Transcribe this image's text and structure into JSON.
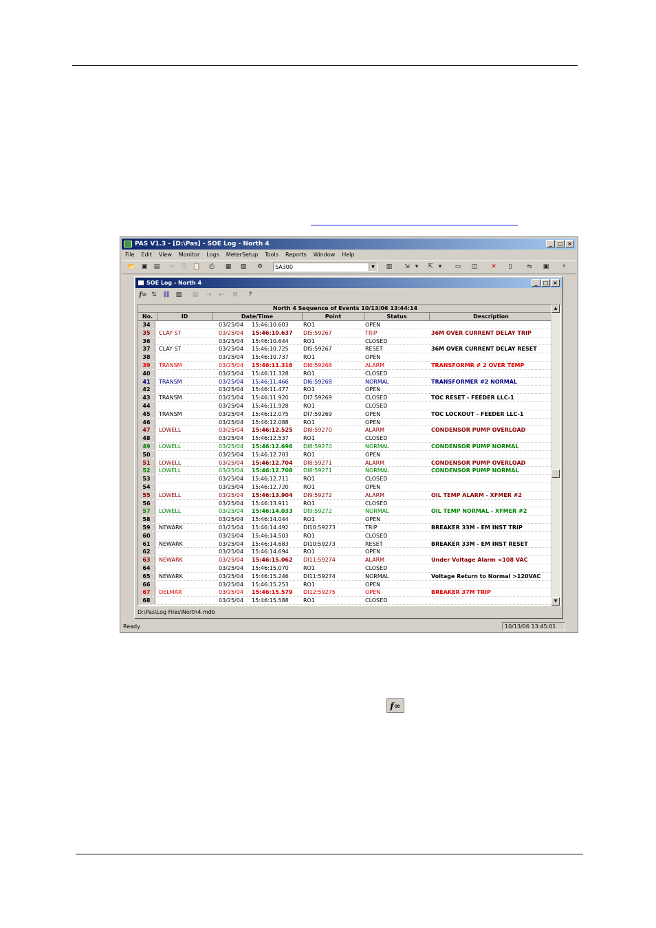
{
  "app": {
    "title": "PAS V1.3 - [D:\\Pas] - SOE Log - North 4",
    "menu": [
      "File",
      "Edit",
      "View",
      "Monitor",
      "Logs",
      "MeterSetup",
      "Tools",
      "Reports",
      "Window",
      "Help"
    ],
    "device_select": "SA300",
    "status_left": "Ready",
    "status_time": "10/13/06 13:45:01"
  },
  "doc": {
    "title": "SOE Log - North 4",
    "header_title": "North 4   Sequence of Events   10/13/06 13:44:14",
    "columns": [
      "No.",
      "ID",
      "Date/Time",
      "Point",
      "Status",
      "Description"
    ],
    "file_path": "D:\\Pas\\Log Files\\North4.mdb"
  },
  "rows": [
    {
      "no": "34",
      "id": "",
      "date": "03/25/04",
      "time": "15:46:10.603",
      "point": "RO1",
      "status": "OPEN",
      "desc": "",
      "color": "black"
    },
    {
      "no": "35",
      "id": "CLAY ST",
      "date": "03/25/04",
      "time": "15:46:10.637",
      "point": "DI5:59267",
      "status": "TRIP",
      "desc": "36M OVER CURRENT DELAY TRIP",
      "color": "darkred"
    },
    {
      "no": "36",
      "id": "",
      "date": "03/25/04",
      "time": "15:46:10.644",
      "point": "RO1",
      "status": "CLOSED",
      "desc": "",
      "color": "black"
    },
    {
      "no": "37",
      "id": "CLAY ST",
      "date": "03/25/04",
      "time": "15:46:10.725",
      "point": "DI5:59267",
      "status": "RESET",
      "desc": "36M OVER CURRENT DELAY RESET",
      "color": "black"
    },
    {
      "no": "38",
      "id": "",
      "date": "03/25/04",
      "time": "15:46:10.737",
      "point": "RO1",
      "status": "OPEN",
      "desc": "",
      "color": "black"
    },
    {
      "no": "39",
      "id": "TRANSM",
      "date": "03/25/04",
      "time": "15:46:11.316",
      "point": "DI6:59268",
      "status": "ALARM",
      "desc": "TRANSFORMR # 2 OVER TEMP",
      "color": "red"
    },
    {
      "no": "40",
      "id": "",
      "date": "03/25/04",
      "time": "15:46:11.328",
      "point": "RO1",
      "status": "CLOSED",
      "desc": "",
      "color": "black"
    },
    {
      "no": "41",
      "id": "TRANSM",
      "date": "03/25/04",
      "time": "15:46:11.466",
      "point": "DI6:59268",
      "status": "NORMAL",
      "desc": "TRANSFORMER #2 NORMAL",
      "color": "navy"
    },
    {
      "no": "42",
      "id": "",
      "date": "03/25/04",
      "time": "15:46:11.477",
      "point": "RO1",
      "status": "OPEN",
      "desc": "",
      "color": "black"
    },
    {
      "no": "43",
      "id": "TRANSM",
      "date": "03/25/04",
      "time": "15:46:11.920",
      "point": "DI7:59269",
      "status": "CLOSED",
      "desc": "TOC RESET - FEEDER LLC-1",
      "color": "black"
    },
    {
      "no": "44",
      "id": "",
      "date": "03/25/04",
      "time": "15:46:11.928",
      "point": "RO1",
      "status": "CLOSED",
      "desc": "",
      "color": "black"
    },
    {
      "no": "45",
      "id": "TRANSM",
      "date": "03/25/04",
      "time": "15:46:12.075",
      "point": "DI7:59269",
      "status": "OPEN",
      "desc": "TOC LOCKOUT - FEEDER LLC-1",
      "color": "black"
    },
    {
      "no": "46",
      "id": "",
      "date": "03/25/04",
      "time": "15:46:12.088",
      "point": "RO1",
      "status": "OPEN",
      "desc": "",
      "color": "black"
    },
    {
      "no": "47",
      "id": "LOWELL",
      "date": "03/25/04",
      "time": "15:46:12.525",
      "point": "DI8:59270",
      "status": "ALARM",
      "desc": "CONDENSOR PUMP OVERLOAD",
      "color": "darkred"
    },
    {
      "no": "48",
      "id": "",
      "date": "03/25/04",
      "time": "15:46:12.537",
      "point": "RO1",
      "status": "CLOSED",
      "desc": "",
      "color": "black"
    },
    {
      "no": "49",
      "id": "LOWELL",
      "date": "03/25/04",
      "time": "15:46:12.696",
      "point": "DI8:59270",
      "status": "NORMAL",
      "desc": "CONDENSOR PUMP NORMAL",
      "color": "green"
    },
    {
      "no": "50",
      "id": "",
      "date": "03/25/04",
      "time": "15:46:12.703",
      "point": "RO1",
      "status": "OPEN",
      "desc": "",
      "color": "black"
    },
    {
      "no": "51",
      "id": "LOWELL",
      "date": "03/25/04",
      "time": "15:46:12.704",
      "point": "DI8:59271",
      "status": "ALARM",
      "desc": "CONDENSOR PUMP OVERLOAD",
      "color": "darkred"
    },
    {
      "no": "52",
      "id": "LOWELL",
      "date": "03/25/04",
      "time": "15:46:12.708",
      "point": "DI8:59271",
      "status": "NORMAL",
      "desc": "CONDENSOR PUMP NORMAL",
      "color": "green"
    },
    {
      "no": "53",
      "id": "",
      "date": "03/25/04",
      "time": "15:46:12.711",
      "point": "RO1",
      "status": "CLOSED",
      "desc": "",
      "color": "black"
    },
    {
      "no": "54",
      "id": "",
      "date": "03/25/04",
      "time": "15:46:12.720",
      "point": "RO1",
      "status": "OPEN",
      "desc": "",
      "color": "black"
    },
    {
      "no": "55",
      "id": "LOWELL",
      "date": "03/25/04",
      "time": "15:46:13.904",
      "point": "DI9:59272",
      "status": "ALARM",
      "desc": "OIL TEMP ALARM - XFMER #2",
      "color": "darkred"
    },
    {
      "no": "56",
      "id": "",
      "date": "03/25/04",
      "time": "15:46:13.911",
      "point": "RO1",
      "status": "CLOSED",
      "desc": "",
      "color": "black"
    },
    {
      "no": "57",
      "id": "LOWELL",
      "date": "03/25/04",
      "time": "15:46:14.033",
      "point": "DI9:59272",
      "status": "NORMAL",
      "desc": "OIL TEMP NORMAL - XFMER #2",
      "color": "green"
    },
    {
      "no": "58",
      "id": "",
      "date": "03/25/04",
      "time": "15:46:14.044",
      "point": "RO1",
      "status": "OPEN",
      "desc": "",
      "color": "black"
    },
    {
      "no": "59",
      "id": "NEWARK",
      "date": "03/25/04",
      "time": "15:46:14.492",
      "point": "DI10:59273",
      "status": "TRIP",
      "desc": "BREAKER 33M - EM INST TRIP",
      "color": "black"
    },
    {
      "no": "60",
      "id": "",
      "date": "03/25/04",
      "time": "15:46:14.503",
      "point": "RO1",
      "status": "CLOSED",
      "desc": "",
      "color": "black"
    },
    {
      "no": "61",
      "id": "NEWARK",
      "date": "03/25/04",
      "time": "15:46:14.683",
      "point": "DI10:59273",
      "status": "RESET",
      "desc": "BREAKER 33M - EM INST RESET",
      "color": "black"
    },
    {
      "no": "62",
      "id": "",
      "date": "03/25/04",
      "time": "15:46:14.694",
      "point": "RO1",
      "status": "OPEN",
      "desc": "",
      "color": "black"
    },
    {
      "no": "63",
      "id": "NEWARK",
      "date": "03/25/04",
      "time": "15:46:15.062",
      "point": "DI11:59274",
      "status": "ALARM",
      "desc": "Under Voltage Alarm <108 VAC",
      "color": "darkred"
    },
    {
      "no": "64",
      "id": "",
      "date": "03/25/04",
      "time": "15:46:15.070",
      "point": "RO1",
      "status": "CLOSED",
      "desc": "",
      "color": "black"
    },
    {
      "no": "65",
      "id": "NEWARK",
      "date": "03/25/04",
      "time": "15:46:15.246",
      "point": "DI11:59274",
      "status": "NORMAL",
      "desc": "Voltage Return to Normal >120VAC",
      "color": "black"
    },
    {
      "no": "66",
      "id": "",
      "date": "03/25/04",
      "time": "15:46:15.253",
      "point": "RO1",
      "status": "OPEN",
      "desc": "",
      "color": "black"
    },
    {
      "no": "67",
      "id": "DELMAR",
      "date": "03/25/04",
      "time": "15:46:15.579",
      "point": "DI12:59275",
      "status": "OPEN",
      "desc": "BREAKER 37M TRIP",
      "color": "red"
    },
    {
      "no": "68",
      "id": "",
      "date": "03/25/04",
      "time": "15:46:15.588",
      "point": "RO1",
      "status": "CLOSED",
      "desc": "",
      "color": "black"
    }
  ],
  "icons": {
    "fx": "f∞"
  }
}
